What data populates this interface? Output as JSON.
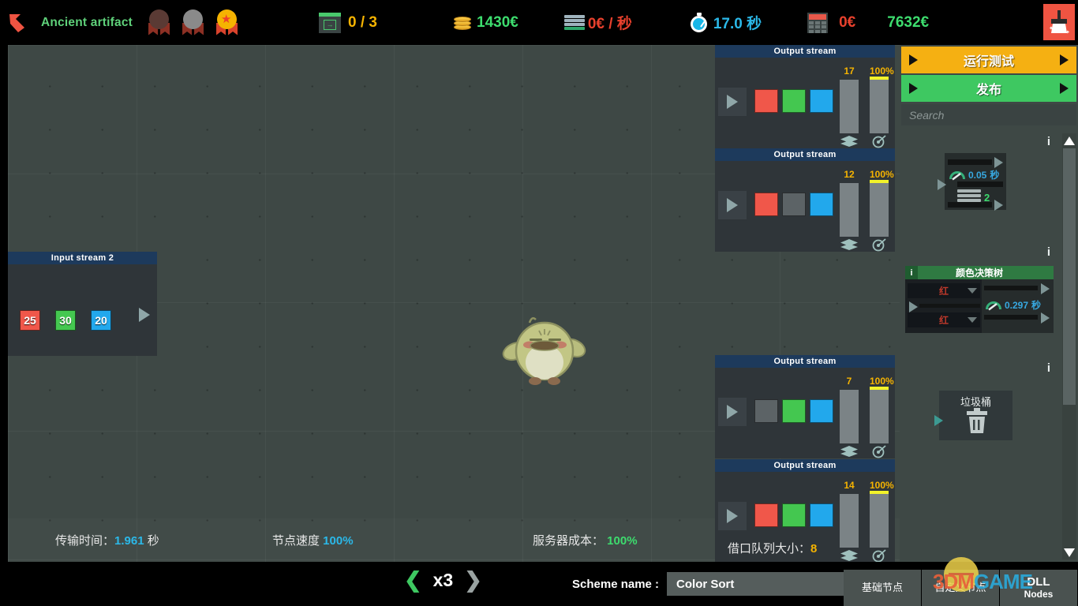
{
  "topbar": {
    "back_icon": "back-arrow-icon",
    "artifact_label": "Ancient artifact",
    "medals": [
      {
        "name": "bronze-medal",
        "color": "#5a3a34"
      },
      {
        "name": "silver-medal",
        "color": "#8a8a8a"
      },
      {
        "name": "gold-medal",
        "color": "#f5b301"
      }
    ],
    "stats": [
      {
        "icon": "export-icon",
        "value": "0 / 3",
        "color": "#f5b301"
      },
      {
        "icon": "coins-icon",
        "value": "1430€",
        "color": "#3ddc6e"
      },
      {
        "icon": "server-rate-icon",
        "value": "0€ / 秒",
        "color": "#e8412d"
      },
      {
        "icon": "timer-icon",
        "value": "17.0 秒",
        "color": "#2bb8e8"
      },
      {
        "icon": "calculator-icon",
        "value": "0€",
        "color": "#e8412d"
      },
      {
        "icon": "",
        "value": "7632€",
        "color": "#3ddc6e"
      }
    ],
    "clean_button": "broom-clean-button"
  },
  "canvas": {
    "mascot": "bird-mascot",
    "footer_stats": [
      {
        "label": "传输时间：",
        "value": "1.961",
        "unit": " 秒",
        "value_color": "#2bb8e8"
      },
      {
        "label": "节点速度 ",
        "value": "100%",
        "unit": "",
        "value_color": "#2bb8e8"
      },
      {
        "label": "服务器成本：",
        "value": " 100%",
        "unit": "",
        "value_color": "#3ddc6e"
      }
    ]
  },
  "input_stream": {
    "title": "Input stream 2",
    "items": [
      {
        "value": "25",
        "color": "#f0574a"
      },
      {
        "value": "30",
        "color": "#44c750"
      },
      {
        "value": "20",
        "color": "#22a8ec"
      }
    ],
    "play_icon": "play-icon"
  },
  "output_streams": [
    {
      "title": "Output stream",
      "chips": [
        "red",
        "green",
        "blue"
      ],
      "count": "17",
      "percent": "100%",
      "queue_label": null,
      "queue_value": null
    },
    {
      "title": "Output stream",
      "chips": [
        "red",
        "gray",
        "blue"
      ],
      "count": "12",
      "percent": "100%",
      "queue_label": null,
      "queue_value": null
    },
    {
      "title": "Output stream",
      "chips": [
        "gray",
        "green",
        "blue"
      ],
      "count": "7",
      "percent": "100%",
      "queue_label": null,
      "queue_value": null
    },
    {
      "title": "Output stream",
      "chips": [
        "red",
        "green",
        "blue"
      ],
      "count": "14",
      "percent": "100%",
      "queue_label": "借口队列大小：",
      "queue_value": "8"
    }
  ],
  "sidebar": {
    "run_test_label": "运行测试",
    "publish_label": "发布",
    "search_placeholder": "Search",
    "nodes": [
      {
        "name": "speed-node",
        "info": "i",
        "speed": "0.05",
        "speed_unit": "秒",
        "count": "2"
      },
      {
        "name": "color-decision-tree-node",
        "info": "i",
        "title": "颜色决策树",
        "option_top": "红",
        "option_bottom": "红",
        "speed": "0.297",
        "speed_unit": "秒"
      },
      {
        "name": "trash-node",
        "info": "i",
        "title": "垃圾桶",
        "icon": "trash-icon"
      }
    ]
  },
  "bottombar": {
    "speed_prev": "❮",
    "speed_value": "x3",
    "speed_next": "❯",
    "scheme_label": "Scheme name :",
    "scheme_value": "Color Sort",
    "tabs": [
      {
        "name": "tab-basic-nodes",
        "label": "基础节点"
      },
      {
        "name": "tab-custom-nodes",
        "label": "自定义节点"
      },
      {
        "name": "tab-dll-nodes",
        "line1": "DLL",
        "line2": "Nodes"
      }
    ]
  },
  "watermark": {
    "part1": "3DM",
    "part2": "GAME"
  }
}
